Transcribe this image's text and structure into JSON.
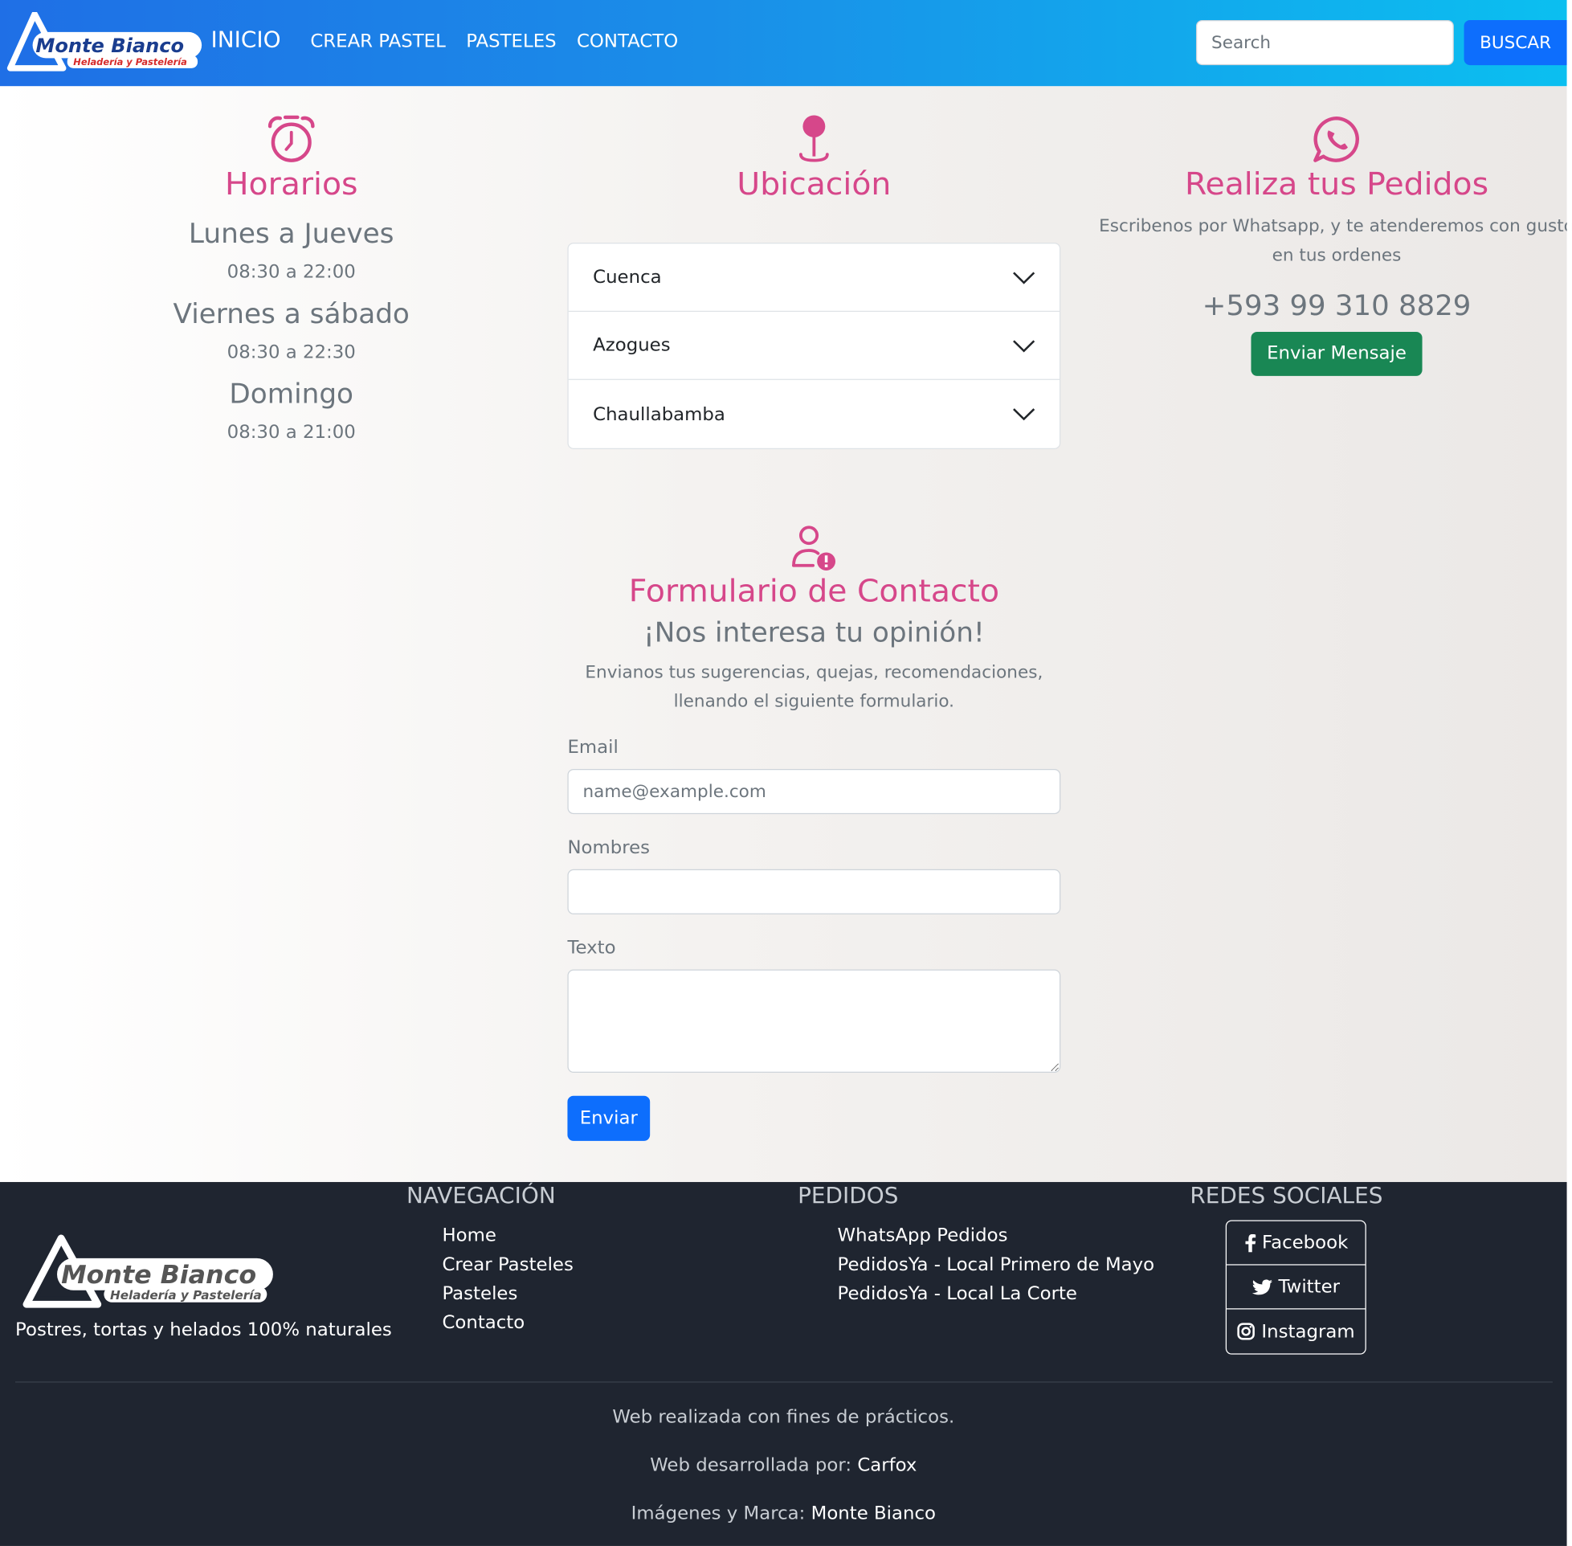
{
  "brand": {
    "name": "Monte Bianco",
    "tagline": "Heladería y Pastelería"
  },
  "nav": {
    "links": [
      "INICIO",
      "CREAR PASTEL",
      "PASTELES",
      "CONTACTO"
    ],
    "search_placeholder": "Search",
    "search_button": "BUSCAR"
  },
  "horarios": {
    "title": "Horarios",
    "schedule": [
      {
        "days": "Lunes a Jueves",
        "hours": "08:30 a 22:00"
      },
      {
        "days": "Viernes a sábado",
        "hours": "08:30 a 22:30"
      },
      {
        "days": "Domingo",
        "hours": "08:30 a 21:00"
      }
    ]
  },
  "ubicacion": {
    "title": "Ubicación",
    "locations": [
      "Cuenca",
      "Azogues",
      "Chaullabamba"
    ]
  },
  "pedidos": {
    "title": "Realiza tus Pedidos",
    "description": "Escribenos por Whatsapp, y te atenderemos con gusto en tus ordenes",
    "phone": "+593 99 310 8829",
    "button": "Enviar Mensaje"
  },
  "contacto": {
    "title": "Formulario de Contacto",
    "subtitle": "¡Nos interesa tu opinión!",
    "description": "Envianos tus sugerencias, quejas, recomendaciones, llenando el siguiente formulario.",
    "email_label": "Email",
    "email_placeholder": "name@example.com",
    "nombres_label": "Nombres",
    "texto_label": "Texto",
    "submit": "Enviar"
  },
  "footer": {
    "tagline": "Postres, tortas y helados 100% naturales",
    "navegacion_title": "NAVEGACIÓN",
    "navegacion": [
      "Home",
      "Crear Pasteles",
      "Pasteles",
      "Contacto"
    ],
    "pedidos_title": "PEDIDOS",
    "pedidos": [
      "WhatsApp Pedidos",
      "PedidosYa - Local Primero de Mayo",
      "PedidosYa - Local La Corte"
    ],
    "redes_title": "REDES SOCIALES",
    "redes": [
      "Facebook",
      "Twitter",
      "Instagram"
    ],
    "credit1": "Web realizada con fines de prácticos.",
    "credit2_prefix": "Web desarrollada por:",
    "credit2_name": "Carfox",
    "credit3_prefix": "Imágenes y Marca:",
    "credit3_name": "Monte Bianco"
  },
  "colors": {
    "accent": "#d6478a",
    "primary": "#0d6efd",
    "success": "#198754",
    "footer": "#1f2530"
  }
}
